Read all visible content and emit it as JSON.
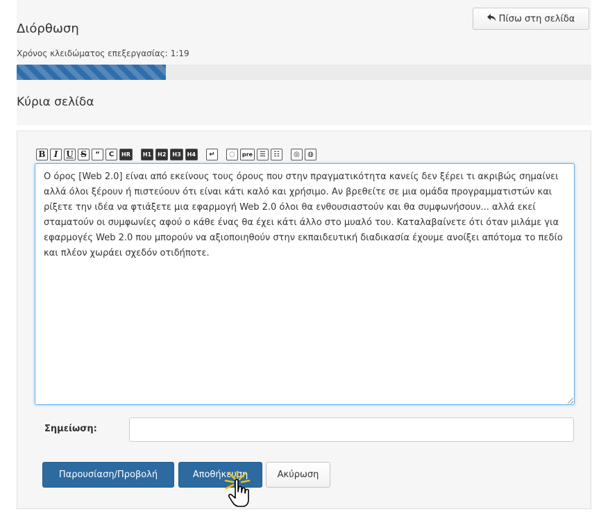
{
  "header": {
    "title": "Διόρθωση",
    "back_button_label": "Πίσω στη σελίδα",
    "back_icon": "reply-arrow-icon"
  },
  "lock": {
    "label": "Χρόνος κλειδώματος επεξεργασίας: 1:19",
    "progress_fraction": 0.26,
    "bar_color": "#2f6eaa"
  },
  "page": {
    "name": "Κύρια σελίδα"
  },
  "toolbar": {
    "buttons": [
      {
        "name": "bold-button",
        "label": "B"
      },
      {
        "name": "italic-button",
        "label": "I"
      },
      {
        "name": "underline-button",
        "label": "U"
      },
      {
        "name": "strikethrough-button",
        "label": "S"
      },
      {
        "name": "quote-button",
        "label": "“"
      },
      {
        "name": "center-button",
        "label": "C"
      },
      {
        "name": "horizontal-rule-button",
        "label": "HR"
      },
      {
        "name": "heading1-button",
        "label": "H1"
      },
      {
        "name": "heading2-button",
        "label": "H2"
      },
      {
        "name": "heading3-button",
        "label": "H3"
      },
      {
        "name": "heading4-button",
        "label": "H4"
      },
      {
        "name": "line-break-button",
        "label": "↵"
      },
      {
        "name": "comment-button",
        "label": "◌"
      },
      {
        "name": "preformatted-button",
        "label": "pre"
      },
      {
        "name": "bullet-list-button",
        "label": "☰"
      },
      {
        "name": "numbered-list-button",
        "label": "☷"
      },
      {
        "name": "internal-link-button",
        "label": "◎"
      },
      {
        "name": "external-link-button",
        "label": "◍"
      }
    ]
  },
  "editor": {
    "content": "Ο όρος [Web 2.0] είναι από εκείνους τους όρους που στην πραγματικότητα κανείς δεν ξέρει τι ακριβώς σημαίνει αλλά όλοι ξέρουν ή πιστεύουν ότι είναι κάτι καλό και χρήσιμο. Αν βρεθείτε σε μια ομάδα προγραμματιστών και ρίξετε την ιδέα να φτιάξετε μια εφαρμογή Web 2.0 όλοι θα ενθουσιαστούν και θα συμφωνήσουν... αλλά εκεί σταματούν οι συμφωνίες αφού ο κάθε ένας θα έχει κάτι άλλο στο μυαλό του. Καταλαβαίνετε ότι όταν μιλάμε για εφαρμογές Web 2.0 που μπορούν να αξιοποιηθούν στην εκπαιδευτική διαδικασία έχουμε ανοίξει απότομα το πεδίο και πλέον χωράει σχεδόν οτιδήποτε."
  },
  "note": {
    "label": "Σημείωση:",
    "value": ""
  },
  "actions": {
    "preview_label": "Παρουσίαση/Προβολή",
    "save_label": "Αποθήκευση",
    "cancel_label": "Ακύρωση"
  },
  "colors": {
    "primary": "#2c6aa0",
    "focus_border": "#66afe9"
  }
}
